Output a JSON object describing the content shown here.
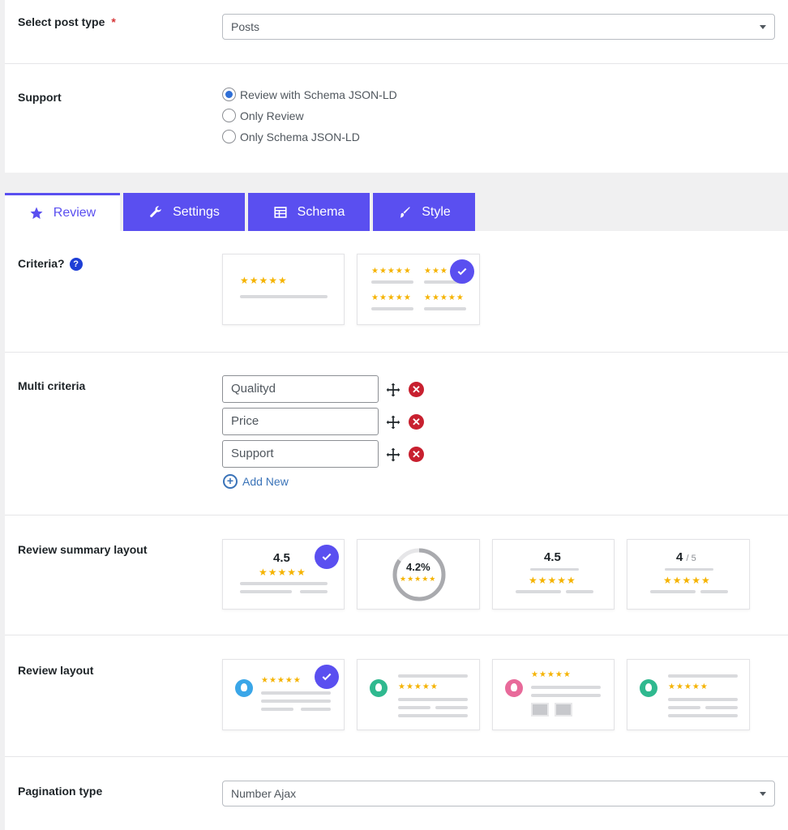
{
  "post_type": {
    "label": "Select post type",
    "required_mark": "*",
    "value": "Posts"
  },
  "support": {
    "label": "Support",
    "options": [
      {
        "label": "Review with Schema JSON-LD",
        "checked": true
      },
      {
        "label": "Only Review",
        "checked": false
      },
      {
        "label": "Only Schema JSON-LD",
        "checked": false
      }
    ]
  },
  "tabs": [
    {
      "label": "Review",
      "icon": "star-icon",
      "active": true
    },
    {
      "label": "Settings",
      "icon": "wrench-icon",
      "active": false
    },
    {
      "label": "Schema",
      "icon": "table-icon",
      "active": false
    },
    {
      "label": "Style",
      "icon": "brush-icon",
      "active": false
    }
  ],
  "criteria": {
    "label": "Criteria?",
    "help": "?",
    "selected": 1
  },
  "multi_criteria": {
    "label": "Multi criteria",
    "items": [
      "Qualityd",
      "Price",
      "Support"
    ],
    "add_new": "Add New"
  },
  "summary_layout": {
    "label": "Review summary layout",
    "selected": 0,
    "cards": [
      {
        "score": "4.5"
      },
      {
        "score": "4.2%"
      },
      {
        "score": "4.5"
      },
      {
        "score": "4",
        "suffix": "/ 5"
      }
    ]
  },
  "review_layout": {
    "label": "Review layout",
    "selected": 0
  },
  "pagination": {
    "label": "Pagination type",
    "value": "Number Ajax"
  },
  "colors": {
    "accent": "#5a4ff0",
    "star": "#f5b301",
    "delete": "#c8202f",
    "link": "#3a73b8"
  }
}
